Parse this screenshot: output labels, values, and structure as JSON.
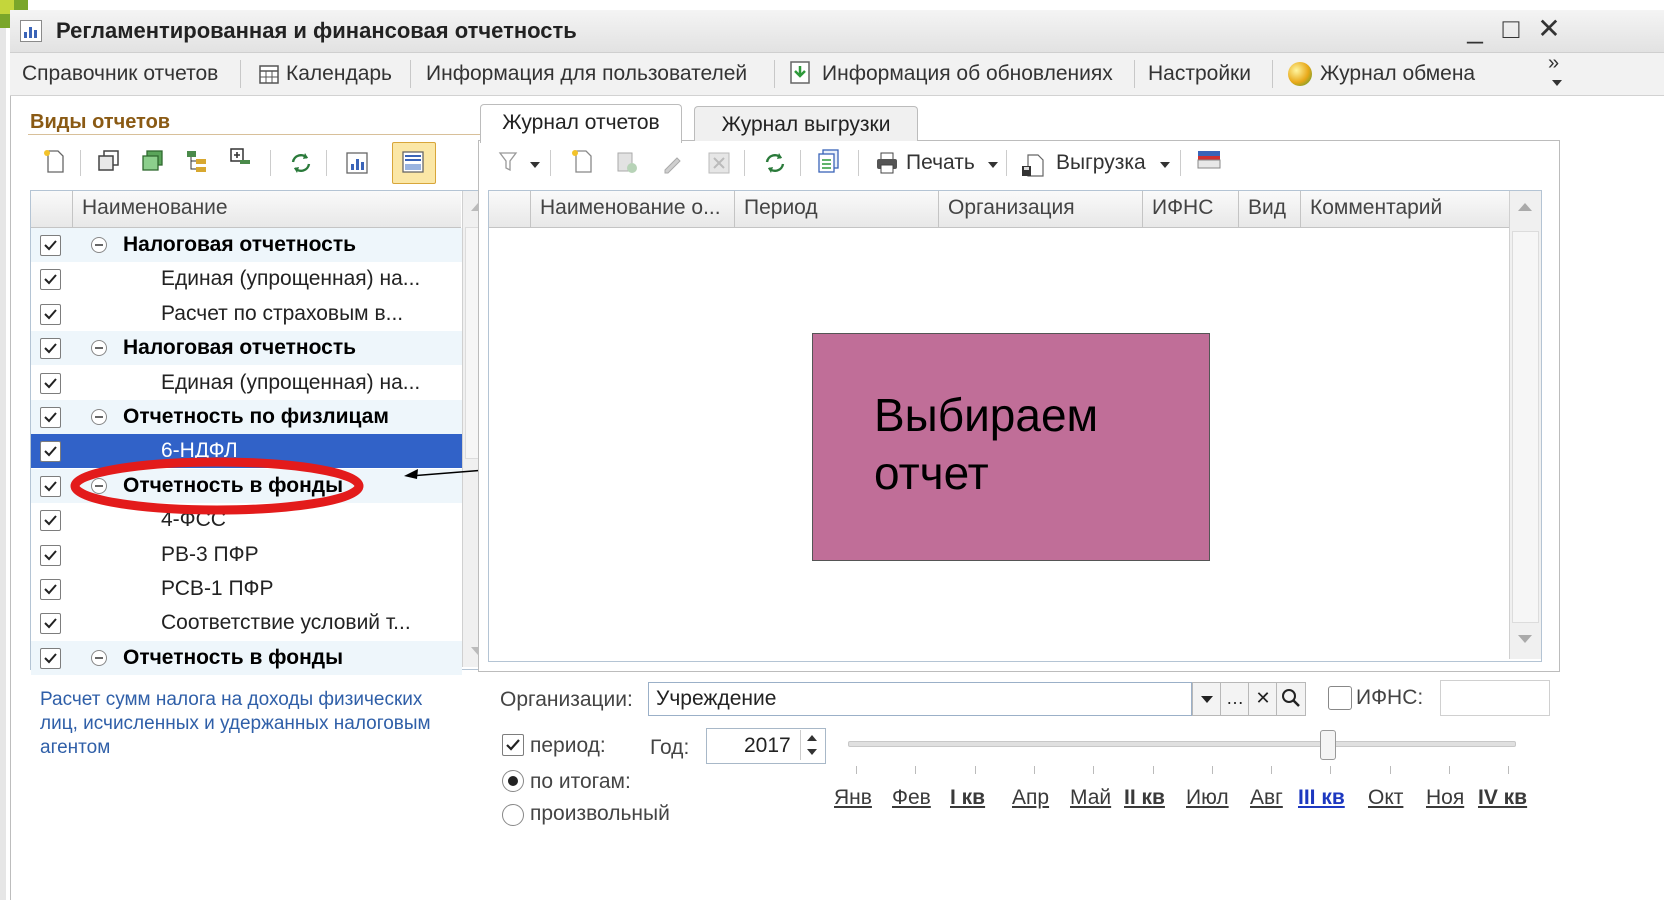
{
  "window": {
    "title": "Регламентированная и финансовая отчетность",
    "min_glyph": "_",
    "max_glyph": "□",
    "close_glyph": "✕"
  },
  "toolbar": {
    "items": [
      "Справочник отчетов",
      "Календарь",
      "Информация для пользователей",
      "Информация об обновлениях",
      "Настройки",
      "Журнал обмена"
    ],
    "overflow_glyph": "»"
  },
  "left": {
    "title": "Виды отчетов",
    "column": "Наименование",
    "rows": [
      {
        "label": "Налоговая отчетность",
        "group": true
      },
      {
        "label": "Единая (упрощенная) на..."
      },
      {
        "label": "Расчет по страховым в..."
      },
      {
        "label": "Налоговая отчетность",
        "group": true
      },
      {
        "label": "Единая (упрощенная) на..."
      },
      {
        "label": "Отчетность по физлицам",
        "group": true
      },
      {
        "label": "6-НДФЛ",
        "selected": true
      },
      {
        "label": "Отчетность в фонды",
        "group": true
      },
      {
        "label": "4-ФСС"
      },
      {
        "label": "РВ-3 ПФР"
      },
      {
        "label": "РСВ-1 ПФР"
      },
      {
        "label": "Соответствие условий т..."
      },
      {
        "label": "Отчетность в фонды",
        "group": true
      }
    ],
    "description": "Расчет сумм налога на доходы физических лиц, исчисленных и удержанных налоговым агентом"
  },
  "tabs": [
    "Журнал отчетов",
    "Журнал выгрузки"
  ],
  "right_toolbar": {
    "print": "Печать",
    "export": "Выгрузка"
  },
  "grid": {
    "columns": [
      "Наименование о...",
      "Период",
      "Организация",
      "ИФНС",
      "Вид",
      "Комментарий"
    ]
  },
  "callout": {
    "line1": "Выбираем",
    "line2": "отчет"
  },
  "filter": {
    "org_label": "Организации:",
    "org_value": "Учреждение",
    "ifns_label": "ИФНС:",
    "period_label": "период:",
    "year_label": "Год:",
    "year_value": "2017",
    "radio_totals": "по итогам:",
    "radio_custom": "произвольный",
    "months": [
      "Янв",
      "Фев",
      "I кв",
      "Апр",
      "Май",
      "II кв",
      "Июл",
      "Авг",
      "III кв",
      "Окт",
      "Ноя",
      "IV кв"
    ]
  },
  "colors": {
    "accent": "#3162c8",
    "callout": "#c06e98",
    "annotation": "#e31b1b",
    "quarter_current": "#1d38c0"
  }
}
